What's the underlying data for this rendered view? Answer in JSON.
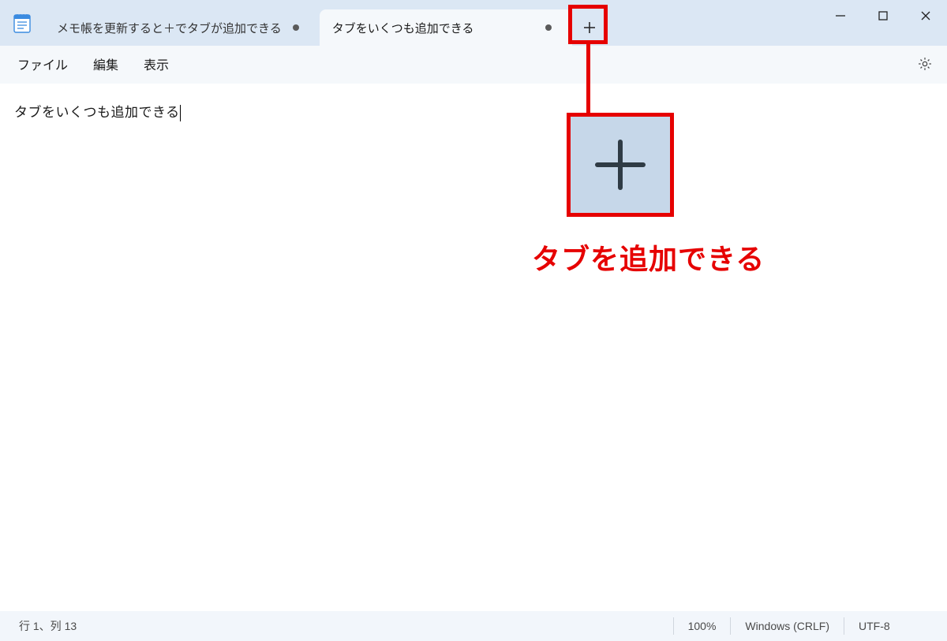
{
  "tabs": [
    {
      "title": "メモ帳を更新すると＋でタブが追加できる",
      "dirty": true,
      "active": false
    },
    {
      "title": "タブをいくつも追加できる",
      "dirty": true,
      "active": true
    }
  ],
  "menu": {
    "file": "ファイル",
    "edit": "編集",
    "view": "表示"
  },
  "editor": {
    "content": "タブをいくつも追加できる"
  },
  "statusbar": {
    "position": "行 1、列 13",
    "zoom": "100%",
    "line_ending": "Windows (CRLF)",
    "encoding": "UTF-8"
  },
  "annotation": {
    "caption": "タブを追加できる"
  }
}
